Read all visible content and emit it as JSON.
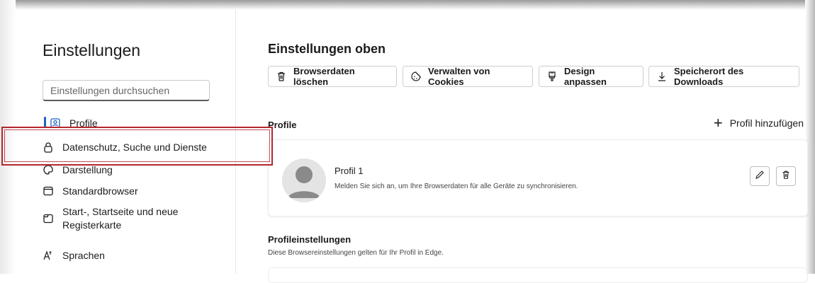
{
  "sidebar": {
    "title": "Einstellungen",
    "search_placeholder": "Einstellungen durchsuchen",
    "items": [
      {
        "label": "Profile",
        "icon": "profile-icon"
      },
      {
        "label": "Datenschutz, Suche und Dienste",
        "icon": "lock-icon"
      },
      {
        "label": "Darstellung",
        "icon": "appearance-icon"
      },
      {
        "label": "Standardbrowser",
        "icon": "browser-icon"
      },
      {
        "label": "Start-, Startseite und neue",
        "label2": "Registerkarte",
        "icon": "start-page-icon"
      },
      {
        "label": "Sprachen",
        "icon": "languages-icon"
      }
    ]
  },
  "main": {
    "title": "Einstellungen oben",
    "buttons": [
      {
        "label": "Browserdaten löschen",
        "icon": "trash-icon"
      },
      {
        "label": "Verwalten von Cookies",
        "icon": "cookie-icon"
      },
      {
        "label": "Design anpassen",
        "icon": "brush-icon"
      },
      {
        "label": "Speicherort des Downloads",
        "icon": "download-icon"
      }
    ],
    "profiles_label": "Profile",
    "add_profile_label": "Profil hinzufügen",
    "profile": {
      "name": "Profil 1",
      "description": "Melden Sie sich an, um Ihre Browserdaten für alle Geräte zu synchronisieren."
    },
    "profile_settings": {
      "title": "Profileinstellungen",
      "description": "Diese Browsereinstellungen gelten für Ihr Profil in Edge."
    }
  },
  "colors": {
    "accent": "#1a62c4",
    "highlight": "#b4262e"
  }
}
